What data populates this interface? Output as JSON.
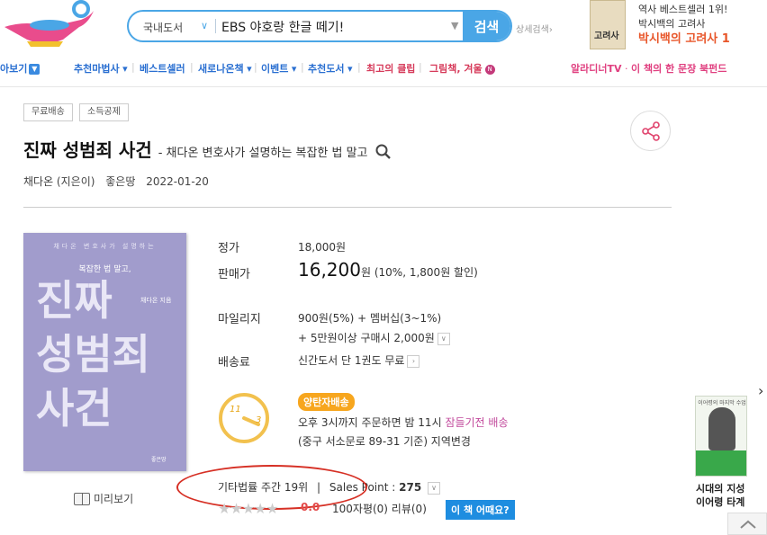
{
  "header": {
    "search_category": "국내도서",
    "search_value": "EBS 야호랑 한글 떼기!",
    "search_button": "검색",
    "detail_search": "상세검색",
    "ad": {
      "line1": "역사 베스트셀러 1위!",
      "line2": "박시백의 고려사",
      "line3": "박시백의 고려사 1",
      "cover_text": "고려사"
    }
  },
  "nav": {
    "items": [
      {
        "label": "아보기"
      },
      {
        "label": "추천마법사"
      },
      {
        "label": "베스트셀러"
      },
      {
        "label": "새로나온책"
      },
      {
        "label": "이벤트"
      },
      {
        "label": "추천도서"
      },
      {
        "label": "최고의 클립"
      },
      {
        "label": "그림책, 겨울"
      }
    ],
    "right_items": [
      {
        "label": "알라디너TV"
      },
      {
        "label": "이 책의 한 문장"
      },
      {
        "label": "북펀드"
      }
    ]
  },
  "product": {
    "tags": [
      "무료배송",
      "소득공제"
    ],
    "title": "진짜 성범죄 사건",
    "subtitle": "- 채다온 변호사가 설명하는 복잡한 법 말고",
    "author": "채다온 (지은이)",
    "publisher": "좋은땅",
    "date": "2022-01-20",
    "cover": {
      "top_text": "채다온 변호사가 설명하는",
      "sub_text": "복잡한 법 말고,",
      "big1": "진짜",
      "big2": "성범죄",
      "big3": "사건",
      "author_small": "채다온 지음",
      "publisher_small": "좋은땅"
    },
    "preview_label": "미리보기"
  },
  "price": {
    "list_label": "정가",
    "list_value": "18,000원",
    "sale_label": "판매가",
    "sale_value": "16,200",
    "sale_unit": "원",
    "sale_discount": "(10%, 1,800원 할인)",
    "mileage_label": "마일리지",
    "mileage_value1": "900원(5%) + 멤버십(3~1%)",
    "mileage_value2": "+ 5만원이상 구매시 2,000원",
    "shipping_label": "배송료",
    "shipping_value": "신간도서 단 1권도 무료"
  },
  "delivery": {
    "badge": "양탄자배송",
    "clock_from": "11",
    "clock_to": "3",
    "line1_prefix": "오후 3시까지 주문하면 밤 11시",
    "line1_highlight": "잠들기전 배송",
    "line2": "(중구 서소문로 89-31 기준) 지역변경"
  },
  "rank": {
    "text": "기타법률 주간 19위",
    "separator": "|",
    "sales_label": "Sales Point :",
    "sales_value": "275"
  },
  "rating": {
    "stars": "★★★★★",
    "score": "0.0",
    "reviews": "100자평(0)   리뷰(0)",
    "how_button": "이 책 어때요?"
  },
  "side_ad": {
    "book_title": "이어령의 마지막 수업",
    "caption1": "시대의 지성",
    "caption2": "이어령 타계"
  }
}
